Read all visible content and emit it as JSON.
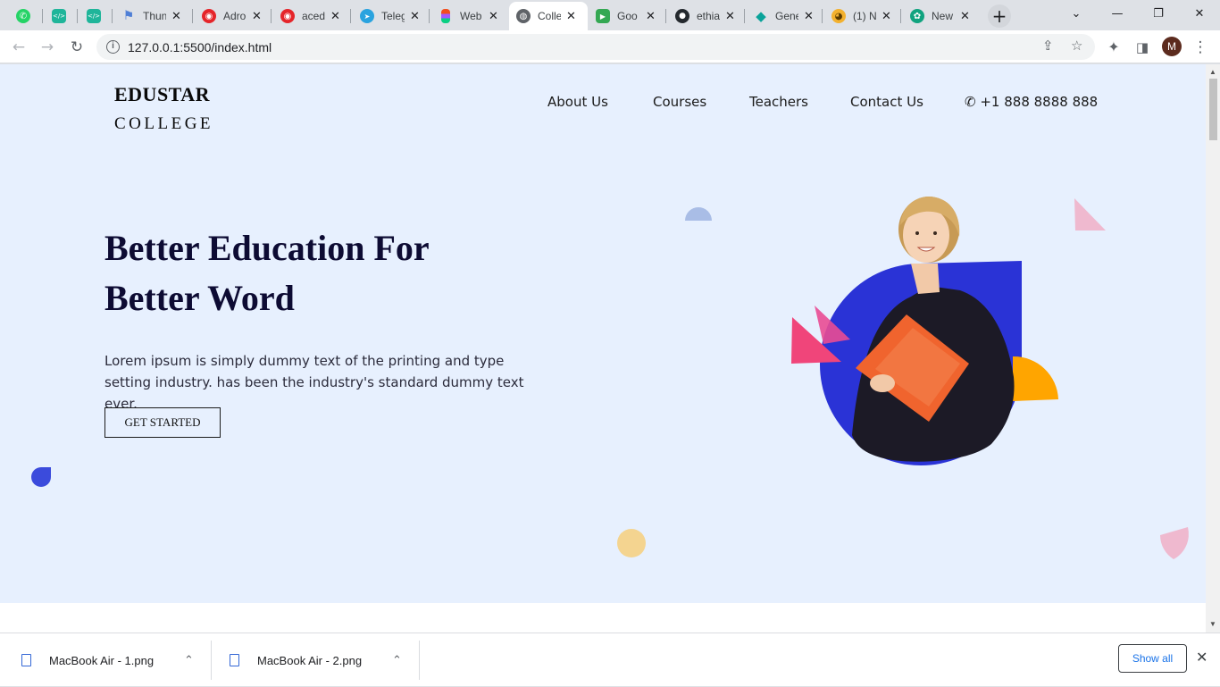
{
  "tabs": [
    {
      "title": "",
      "icon": "whatsapp-icon",
      "color": "#25d366",
      "glyph": "✆"
    },
    {
      "title": "",
      "icon": "code-icon",
      "color": "#1fb59a",
      "glyph": "</>"
    },
    {
      "title": "",
      "icon": "code-icon",
      "color": "#1fb59a",
      "glyph": "</>"
    },
    {
      "title": "Thun",
      "icon": "flag-icon",
      "color": "#4f7fd6",
      "glyph": "⚑"
    },
    {
      "title": "Adro",
      "icon": "compass-icon",
      "color": "#e5252a",
      "glyph": "◉"
    },
    {
      "title": "aced",
      "icon": "compass-icon",
      "color": "#e5252a",
      "glyph": "◉"
    },
    {
      "title": "Teleg",
      "icon": "telegram-icon",
      "color": "#2aa3df",
      "glyph": "➤"
    },
    {
      "title": "Web",
      "icon": "figma-icon",
      "color": "#f24e1e",
      "glyph": "◆"
    },
    {
      "title": "Colle",
      "icon": "globe-icon",
      "color": "#5f6368",
      "glyph": "◍"
    },
    {
      "title": "Goo",
      "icon": "meet-icon",
      "color": "#34a853",
      "glyph": "▶"
    },
    {
      "title": "ethia",
      "icon": "github-icon",
      "color": "#24292e",
      "glyph": "●"
    },
    {
      "title": "Gene",
      "icon": "diamond-icon",
      "color": "#0aa39a",
      "glyph": "◆"
    },
    {
      "title": "(1) N",
      "icon": "cat-icon",
      "color": "#f3b12f",
      "glyph": "◕"
    },
    {
      "title": "New",
      "icon": "openai-icon",
      "color": "#10a37f",
      "glyph": "✿"
    }
  ],
  "browser": {
    "url": "127.0.0.1:5500/index.html",
    "profile_initial": "M"
  },
  "site": {
    "logo_line1": "EDUSTAR",
    "logo_line2": "COLLEGE",
    "nav": [
      "About Us",
      "Courses",
      "Teachers",
      "Contact Us"
    ],
    "phone": "+1 888 8888 888",
    "hero_title_line1": "Better Education For",
    "hero_title_line2": "Better Word",
    "hero_desc": "Lorem ipsum is simply dummy text of the printing and type setting industry. has been the industry's standard dummy text ever.",
    "cta": "GET STARTED"
  },
  "downloads": {
    "items": [
      "MacBook Air - 1.png",
      "MacBook Air - 2.png"
    ],
    "show_all": "Show all"
  },
  "colors": {
    "hero_bg": "#e7f0fe",
    "accent_blue": "#2a33d6",
    "accent_orange": "#ffa500",
    "accent_pink": "#f0457a",
    "heading": "#0d0b33"
  }
}
